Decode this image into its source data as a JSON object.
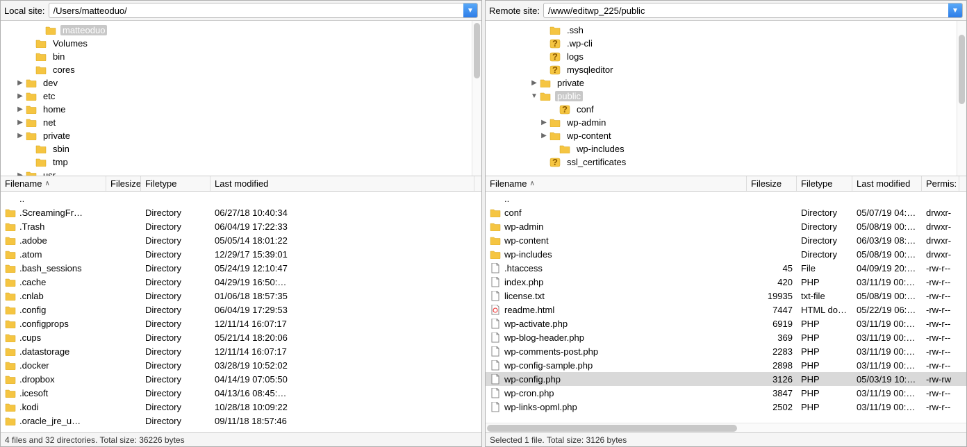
{
  "local": {
    "path_label": "Local site:",
    "path_value": "/Users/matteoduo/",
    "tree": [
      {
        "indent": 42,
        "expander": "",
        "icon": "folder",
        "label": "matteoduo",
        "selected": true
      },
      {
        "indent": 28,
        "expander": "",
        "icon": "folder",
        "label": "Volumes"
      },
      {
        "indent": 28,
        "expander": "",
        "icon": "folder",
        "label": "bin"
      },
      {
        "indent": 28,
        "expander": "",
        "icon": "folder",
        "label": "cores"
      },
      {
        "indent": 14,
        "expander": "▶",
        "icon": "folder",
        "label": "dev"
      },
      {
        "indent": 14,
        "expander": "▶",
        "icon": "folder",
        "label": "etc"
      },
      {
        "indent": 14,
        "expander": "▶",
        "icon": "folder",
        "label": "home"
      },
      {
        "indent": 14,
        "expander": "▶",
        "icon": "folder",
        "label": "net"
      },
      {
        "indent": 14,
        "expander": "▶",
        "icon": "folder",
        "label": "private"
      },
      {
        "indent": 28,
        "expander": "",
        "icon": "folder",
        "label": "sbin"
      },
      {
        "indent": 28,
        "expander": "",
        "icon": "folder",
        "label": "tmp"
      },
      {
        "indent": 14,
        "expander": "▶",
        "icon": "folder",
        "label": "usr"
      }
    ],
    "columns": {
      "filename": "Filename",
      "filesize": "Filesize",
      "filetype": "Filetype",
      "last_modified": "Last modified"
    },
    "files": [
      {
        "icon": "",
        "name": "..",
        "filesize": "",
        "filetype": "",
        "modified": "",
        "permissions": ""
      },
      {
        "icon": "folder",
        "name": ".ScreamingFr…",
        "filesize": "",
        "filetype": "Directory",
        "modified": "06/27/18 10:40:34"
      },
      {
        "icon": "folder",
        "name": ".Trash",
        "filesize": "",
        "filetype": "Directory",
        "modified": "06/04/19 17:22:33"
      },
      {
        "icon": "folder",
        "name": ".adobe",
        "filesize": "",
        "filetype": "Directory",
        "modified": "05/05/14 18:01:22"
      },
      {
        "icon": "folder",
        "name": ".atom",
        "filesize": "",
        "filetype": "Directory",
        "modified": "12/29/17 15:39:01"
      },
      {
        "icon": "folder",
        "name": ".bash_sessions",
        "filesize": "",
        "filetype": "Directory",
        "modified": "05/24/19 12:10:47"
      },
      {
        "icon": "folder",
        "name": ".cache",
        "filesize": "",
        "filetype": "Directory",
        "modified": "04/29/19 16:50:…"
      },
      {
        "icon": "folder",
        "name": ".cnlab",
        "filesize": "",
        "filetype": "Directory",
        "modified": "01/06/18 18:57:35"
      },
      {
        "icon": "folder",
        "name": ".config",
        "filesize": "",
        "filetype": "Directory",
        "modified": "06/04/19 17:29:53"
      },
      {
        "icon": "folder",
        "name": ".configprops",
        "filesize": "",
        "filetype": "Directory",
        "modified": "12/11/14 16:07:17"
      },
      {
        "icon": "folder",
        "name": ".cups",
        "filesize": "",
        "filetype": "Directory",
        "modified": "05/21/14 18:20:06"
      },
      {
        "icon": "folder",
        "name": ".datastorage",
        "filesize": "",
        "filetype": "Directory",
        "modified": "12/11/14 16:07:17"
      },
      {
        "icon": "folder",
        "name": ".docker",
        "filesize": "",
        "filetype": "Directory",
        "modified": "03/28/19 10:52:02"
      },
      {
        "icon": "folder",
        "name": ".dropbox",
        "filesize": "",
        "filetype": "Directory",
        "modified": "04/14/19 07:05:50"
      },
      {
        "icon": "folder",
        "name": ".icesoft",
        "filesize": "",
        "filetype": "Directory",
        "modified": "04/13/16 08:45:…"
      },
      {
        "icon": "folder",
        "name": ".kodi",
        "filesize": "",
        "filetype": "Directory",
        "modified": "10/28/18 10:09:22"
      },
      {
        "icon": "folder",
        "name": ".oracle_jre_u…",
        "filesize": "",
        "filetype": "Directory",
        "modified": "09/11/18 18:57:46"
      }
    ],
    "col_widths": {
      "name": 152,
      "filesize": 50,
      "filetype": 100,
      "modified": 380
    },
    "status": "4 files and 32 directories. Total size: 36226 bytes"
  },
  "remote": {
    "path_label": "Remote site:",
    "path_value": "/www/editwp_225/public",
    "tree": [
      {
        "indent": 70,
        "expander": "",
        "icon": "folder",
        "label": ".ssh"
      },
      {
        "indent": 70,
        "expander": "",
        "icon": "question",
        "label": ".wp-cli"
      },
      {
        "indent": 70,
        "expander": "",
        "icon": "question",
        "label": "logs"
      },
      {
        "indent": 70,
        "expander": "",
        "icon": "question",
        "label": "mysqleditor"
      },
      {
        "indent": 56,
        "expander": "▶",
        "icon": "folder",
        "label": "private"
      },
      {
        "indent": 56,
        "expander": "▼",
        "icon": "folder",
        "label": "public",
        "selected": true
      },
      {
        "indent": 84,
        "expander": "",
        "icon": "question",
        "label": "conf"
      },
      {
        "indent": 70,
        "expander": "▶",
        "icon": "folder",
        "label": "wp-admin"
      },
      {
        "indent": 70,
        "expander": "▶",
        "icon": "folder",
        "label": "wp-content"
      },
      {
        "indent": 84,
        "expander": "",
        "icon": "folder",
        "label": "wp-includes"
      },
      {
        "indent": 70,
        "expander": "",
        "icon": "question",
        "label": "ssl_certificates"
      }
    ],
    "columns": {
      "filename": "Filename",
      "filesize": "Filesize",
      "filetype": "Filetype",
      "last_modified": "Last modified",
      "permissions": "Permis:"
    },
    "files": [
      {
        "icon": "",
        "name": "..",
        "filesize": "",
        "filetype": "",
        "modified": "",
        "permissions": ""
      },
      {
        "icon": "folder",
        "name": "conf",
        "filesize": "",
        "filetype": "Directory",
        "modified": "05/07/19 04:…",
        "permissions": "drwxr-"
      },
      {
        "icon": "folder",
        "name": "wp-admin",
        "filesize": "",
        "filetype": "Directory",
        "modified": "05/08/19 00:…",
        "permissions": "drwxr-"
      },
      {
        "icon": "folder",
        "name": "wp-content",
        "filesize": "",
        "filetype": "Directory",
        "modified": "06/03/19 08:…",
        "permissions": "drwxr-"
      },
      {
        "icon": "folder",
        "name": "wp-includes",
        "filesize": "",
        "filetype": "Directory",
        "modified": "05/08/19 00:…",
        "permissions": "drwxr-"
      },
      {
        "icon": "doc",
        "name": ".htaccess",
        "filesize": "45",
        "filetype": "File",
        "modified": "04/09/19 20:…",
        "permissions": "-rw-r--"
      },
      {
        "icon": "doc",
        "name": "index.php",
        "filesize": "420",
        "filetype": "PHP",
        "modified": "03/11/19 00:…",
        "permissions": "-rw-r--"
      },
      {
        "icon": "doc",
        "name": "license.txt",
        "filesize": "19935",
        "filetype": "txt-file",
        "modified": "05/08/19 00:…",
        "permissions": "-rw-r--"
      },
      {
        "icon": "html",
        "name": "readme.html",
        "filesize": "7447",
        "filetype": "HTML do…",
        "modified": "05/22/19 06:…",
        "permissions": "-rw-r--"
      },
      {
        "icon": "doc",
        "name": "wp-activate.php",
        "filesize": "6919",
        "filetype": "PHP",
        "modified": "03/11/19 00:…",
        "permissions": "-rw-r--"
      },
      {
        "icon": "doc",
        "name": "wp-blog-header.php",
        "filesize": "369",
        "filetype": "PHP",
        "modified": "03/11/19 00:…",
        "permissions": "-rw-r--"
      },
      {
        "icon": "doc",
        "name": "wp-comments-post.php",
        "filesize": "2283",
        "filetype": "PHP",
        "modified": "03/11/19 00:…",
        "permissions": "-rw-r--"
      },
      {
        "icon": "doc",
        "name": "wp-config-sample.php",
        "filesize": "2898",
        "filetype": "PHP",
        "modified": "03/11/19 00:…",
        "permissions": "-rw-r--"
      },
      {
        "icon": "doc",
        "name": "wp-config.php",
        "filesize": "3126",
        "filetype": "PHP",
        "modified": "05/03/19 10:…",
        "permissions": "-rw-rw",
        "selected": true
      },
      {
        "icon": "doc",
        "name": "wp-cron.php",
        "filesize": "3847",
        "filetype": "PHP",
        "modified": "03/11/19 00:…",
        "permissions": "-rw-r--"
      },
      {
        "icon": "doc",
        "name": "wp-links-opml.php",
        "filesize": "2502",
        "filetype": "PHP",
        "modified": "03/11/19 00:…",
        "permissions": "-rw-r--"
      }
    ],
    "col_widths": {
      "name": 376,
      "filesize": 72,
      "filetype": 80,
      "modified": 100,
      "permissions": 54
    },
    "status": "Selected 1 file. Total size: 3126 bytes"
  }
}
